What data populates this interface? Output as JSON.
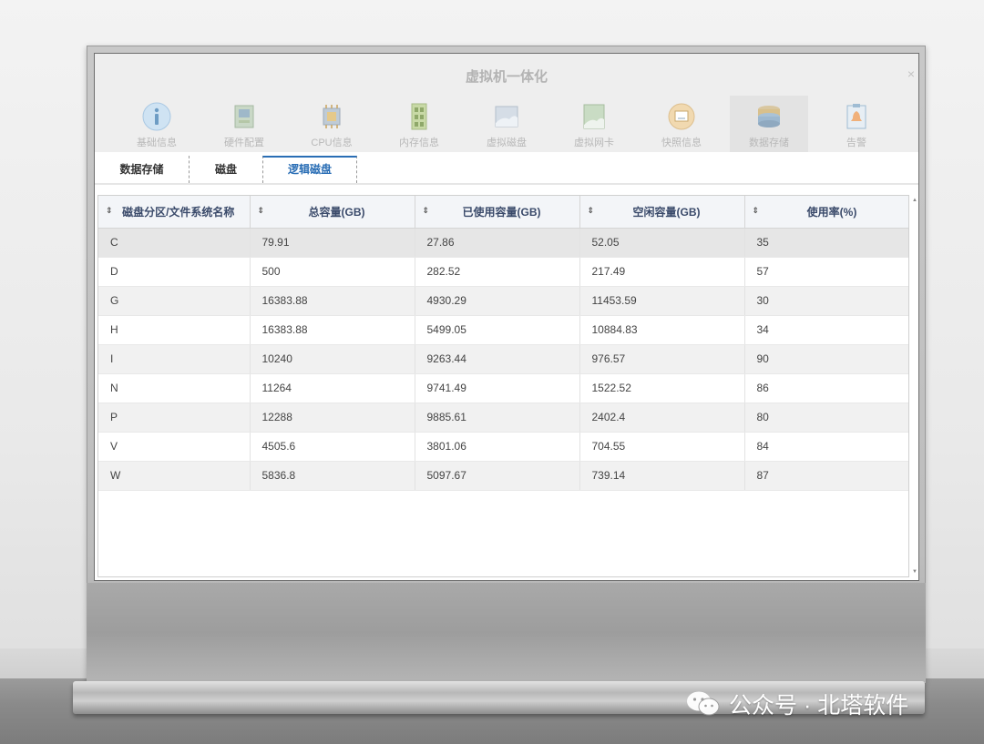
{
  "dialog": {
    "title": "虚拟机一体化",
    "close_glyph": "×"
  },
  "nav": {
    "items": [
      {
        "label": "基础信息",
        "icon": "info-icon"
      },
      {
        "label": "硬件配置",
        "icon": "hardware-icon"
      },
      {
        "label": "CPU信息",
        "icon": "cpu-icon"
      },
      {
        "label": "内存信息",
        "icon": "memory-icon"
      },
      {
        "label": "虚拟磁盘",
        "icon": "disk-icon"
      },
      {
        "label": "虚拟网卡",
        "icon": "network-card-icon"
      },
      {
        "label": "快照信息",
        "icon": "snapshot-icon"
      },
      {
        "label": "数据存储",
        "icon": "storage-icon"
      },
      {
        "label": "告警",
        "icon": "alert-icon"
      }
    ],
    "active": "数据存储"
  },
  "tabs": {
    "items": [
      "数据存储",
      "磁盘",
      "逻辑磁盘"
    ],
    "active": "逻辑磁盘"
  },
  "table": {
    "sort_glyph": "⇕",
    "headers": [
      "磁盘分区/文件系统名称",
      "总容量(GB)",
      "已使用容量(GB)",
      "空闲容量(GB)",
      "使用率(%)"
    ],
    "rows": [
      [
        "C",
        "79.91",
        "27.86",
        "52.05",
        "35"
      ],
      [
        "D",
        "500",
        "282.52",
        "217.49",
        "57"
      ],
      [
        "G",
        "16383.88",
        "4930.29",
        "11453.59",
        "30"
      ],
      [
        "H",
        "16383.88",
        "5499.05",
        "10884.83",
        "34"
      ],
      [
        "I",
        "10240",
        "9263.44",
        "976.57",
        "90"
      ],
      [
        "N",
        "11264",
        "9741.49",
        "1522.52",
        "86"
      ],
      [
        "P",
        "12288",
        "9885.61",
        "2402.4",
        "80"
      ],
      [
        "V",
        "4505.6",
        "3801.06",
        "704.55",
        "84"
      ],
      [
        "W",
        "5836.8",
        "5097.67",
        "739.14",
        "87"
      ]
    ]
  },
  "watermark": {
    "text": "公众号 · 北塔软件",
    "icon": "wechat-icon"
  },
  "colors": {
    "accent": "#2a6eb5",
    "header_text": "#3a4a6a"
  }
}
